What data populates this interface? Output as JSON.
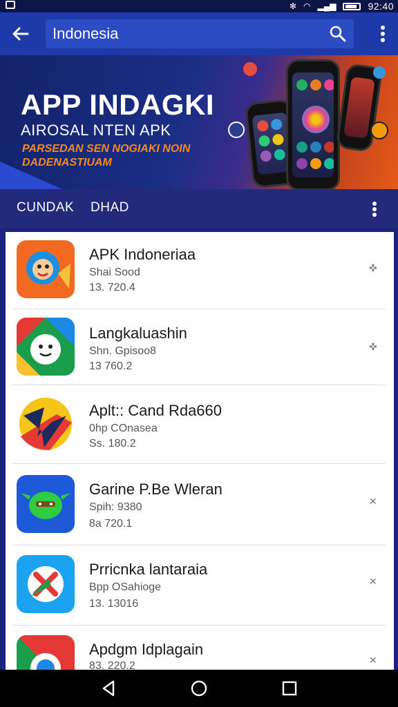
{
  "status_bar": {
    "time": "92:40"
  },
  "toolbar": {
    "search_query": "Indonesia"
  },
  "banner": {
    "title": "APP INDAGKI",
    "subtitle": "AIROSAL NTEN APK",
    "tagline": "PARSEDAN SEN NOGIAKI NOIN DADENASTIUAM"
  },
  "section": {
    "tab_1": "CUNDAK",
    "tab_2": "DHAD"
  },
  "apps": [
    {
      "name": "APK Indoneriaa",
      "meta1": "Shai Sood",
      "meta2": "13. 720.4",
      "icon": "orange-face-icon"
    },
    {
      "name": "Langkaluashin",
      "meta1": "Shn. Gpisoo8",
      "meta2": "13  760.2",
      "icon": "green-face-icon"
    },
    {
      "name": "Aplt:: Cand Rda660",
      "meta1": "0hp COnasea",
      "meta2": "Ss. 180.2",
      "icon": "red-arrow-icon"
    },
    {
      "name": "Garine P.Be Wleran",
      "meta1": "Spih: 9380",
      "meta2": "8a  720.1",
      "icon": "goblin-icon"
    },
    {
      "name": "Prricnka lantaraia",
      "meta1": "Bpp OSahioge",
      "meta2": "13. 13016",
      "icon": "blue-x-icon"
    },
    {
      "name": "Apdgm Idplagain",
      "meta1": "",
      "meta2": "83. 220.2",
      "icon": "chrome-like-icon"
    }
  ],
  "colors": {
    "toolbar": "#1e3aa8",
    "section": "#232a7c",
    "accent_orange": "#f08a24"
  }
}
